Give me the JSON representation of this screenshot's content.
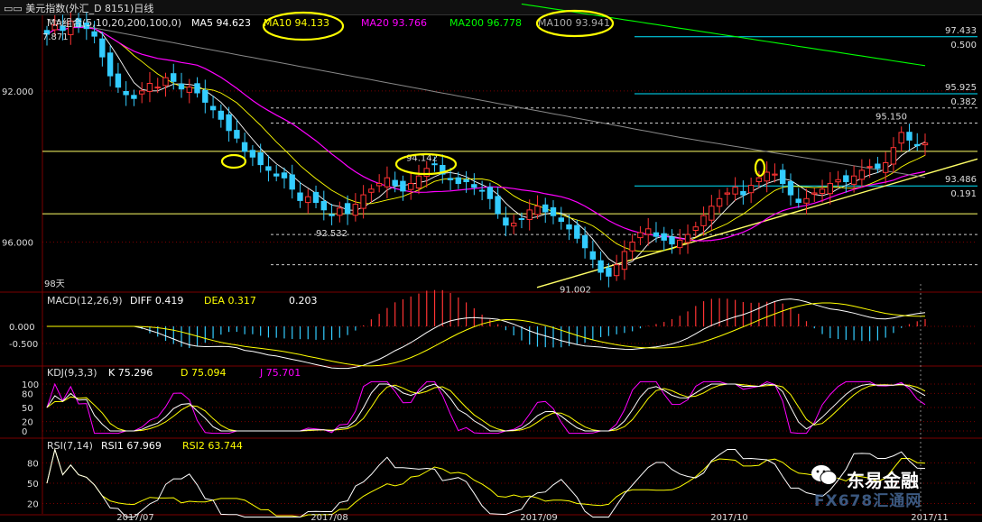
{
  "header": {
    "menu_glyph": "▭▭",
    "title": "美元指数(外汇_D 8151)日线"
  },
  "colors": {
    "up": "#ff3333",
    "down": "#33ccff",
    "ma5": "#ffffff",
    "ma10": "#ffff00",
    "ma20": "#ff00ff",
    "ma200": "#00ff00",
    "ma100": "#888888",
    "fib": "#00e5ff",
    "hline": "#ffff66"
  },
  "main_panel": {
    "legend": [
      {
        "text": "MA组合(5,10,20,200,100,0)",
        "color": "#dddddd"
      },
      {
        "text": "MA5 94.623",
        "color": "#ffffff"
      },
      {
        "text": "MA10 94.133",
        "color": "#ffff00"
      },
      {
        "text": "MA20 93.766",
        "color": "#ff00ff"
      },
      {
        "text": "MA200 96.778",
        "color": "#00ff00"
      },
      {
        "text": "MA100 93.941",
        "color": "#aaaaaa"
      }
    ],
    "top_value": "7.871",
    "y_labels": [
      "96.000",
      "92.000"
    ],
    "annotations": {
      "low1": "92.532",
      "low2": "91.002",
      "mid": "94.142",
      "recent_high": "95.150",
      "days": "98天"
    },
    "fib_labels": [
      {
        "price": "97.433",
        "ratio": "0.500"
      },
      {
        "price": "95.925",
        "ratio": "0.382"
      },
      {
        "price": "93.486",
        "ratio": "0.191"
      }
    ]
  },
  "macd_panel": {
    "legend": [
      {
        "text": "MACD(12,26,9)",
        "color": "#dddddd"
      },
      {
        "text": "DIFF  0.419",
        "color": "#ffffff"
      },
      {
        "text": "DEA  0.317",
        "color": "#ffff00"
      },
      {
        "text": "0.203",
        "color": "#ffffff"
      }
    ],
    "y_labels": [
      "0.000",
      "-0.500"
    ]
  },
  "kdj_panel": {
    "legend": [
      {
        "text": "KDJ(9,3,3)",
        "color": "#dddddd"
      },
      {
        "text": "K  75.296",
        "color": "#ffffff"
      },
      {
        "text": "D  75.094",
        "color": "#ffff00"
      },
      {
        "text": "J  75.701",
        "color": "#ff00ff"
      }
    ],
    "y_labels": [
      "100",
      "80",
      "50",
      "20",
      "0"
    ]
  },
  "rsi_panel": {
    "legend": [
      {
        "text": "RSI(7,14)",
        "color": "#dddddd"
      },
      {
        "text": "RSI1  67.969",
        "color": "#ffffff"
      },
      {
        "text": "RSI2  63.744",
        "color": "#ffff00"
      }
    ],
    "y_labels": [
      "80",
      "50",
      "20"
    ]
  },
  "x_labels": [
    "2017/07",
    "2017/08",
    "2017/09",
    "2017/10",
    "2017/11"
  ],
  "watermark": {
    "name": "东易金融",
    "sub": "FX678汇通网"
  },
  "chart_data": {
    "type": "candlestick",
    "title": "美元指数(外汇_D 8151)日线",
    "ylim": [
      90.7,
      98.0
    ],
    "y_ticks": [
      92.0,
      96.0
    ],
    "closes": [
      97.5,
      97.75,
      97.6,
      97.85,
      97.7,
      97.65,
      97.45,
      96.9,
      96.4,
      96.1,
      95.9,
      95.8,
      96.0,
      96.2,
      96.1,
      96.35,
      96.25,
      96.05,
      96.1,
      95.95,
      95.7,
      95.5,
      95.25,
      94.95,
      94.75,
      94.4,
      94.25,
      94.05,
      93.9,
      93.75,
      93.7,
      93.4,
      93.1,
      93.2,
      93.05,
      92.85,
      92.7,
      92.9,
      92.75,
      93.0,
      93.25,
      93.4,
      93.55,
      93.7,
      93.5,
      93.35,
      93.55,
      93.75,
      93.95,
      94.05,
      93.8,
      93.65,
      93.55,
      93.6,
      93.45,
      93.35,
      93.15,
      92.75,
      92.45,
      92.5,
      92.6,
      92.85,
      92.95,
      92.8,
      92.7,
      92.55,
      92.35,
      92.1,
      91.85,
      91.55,
      91.2,
      91.1,
      91.4,
      91.75,
      92.0,
      92.25,
      92.35,
      92.15,
      92.05,
      91.95,
      92.05,
      92.2,
      92.4,
      92.7,
      92.95,
      93.15,
      93.3,
      93.45,
      93.25,
      93.5,
      93.7,
      93.85,
      93.8,
      93.55,
      93.25,
      93.05,
      93.15,
      93.3,
      93.4,
      93.55,
      93.65,
      93.6,
      93.75,
      93.9,
      94.0,
      93.95,
      94.1,
      94.5,
      94.9,
      94.7,
      94.55,
      94.62
    ],
    "horizontal_levels": [
      {
        "price": 97.433,
        "ratio": 0.5
      },
      {
        "price": 95.925,
        "ratio": 0.382
      },
      {
        "price": 93.486,
        "ratio": 0.191
      }
    ],
    "marked_lows": [
      92.532,
      91.002
    ],
    "marked_levels": [
      94.142,
      95.15
    ],
    "series_last": {
      "MA5": 94.623,
      "MA10": 94.133,
      "MA20": 93.766,
      "MA200": 96.778,
      "MA100": 93.941
    },
    "macd": {
      "DIFF": 0.419,
      "DEA": 0.317,
      "MACD": 0.203
    },
    "kdj": {
      "K": 75.296,
      "D": 75.094,
      "J": 75.701
    },
    "rsi": {
      "RSI1": 67.969,
      "RSI2": 63.744
    },
    "x_tick_labels": [
      "2017/07",
      "2017/08",
      "2017/09",
      "2017/10",
      "2017/11"
    ]
  }
}
